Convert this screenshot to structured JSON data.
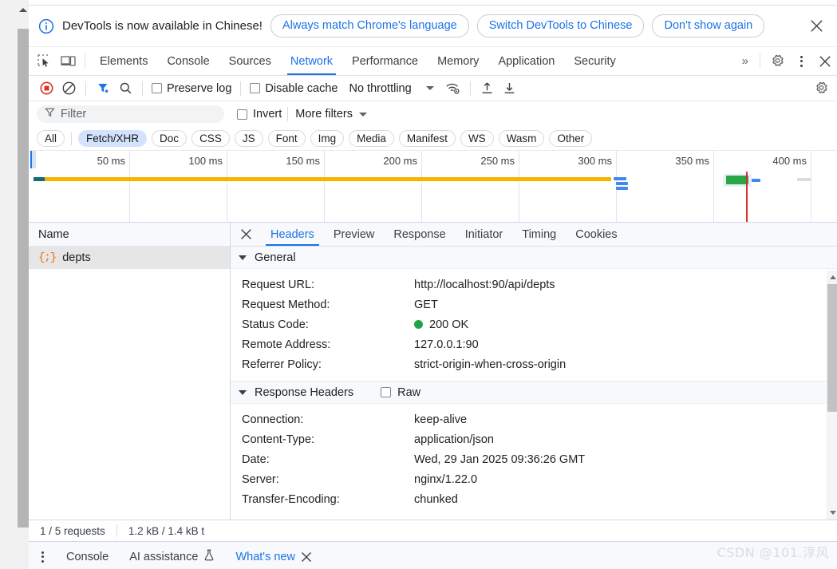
{
  "banner": {
    "icon": "info-circle-icon",
    "message": "DevTools is now available in Chinese!",
    "buttons": [
      {
        "label": "Always match Chrome's language"
      },
      {
        "label": "Switch DevTools to Chinese"
      },
      {
        "label": "Don't show again"
      }
    ],
    "close_icon": "close-icon"
  },
  "tabbar": {
    "inspect_icon": "inspect-element-icon",
    "device_icon": "device-toolbar-icon",
    "tabs": [
      {
        "label": "Elements",
        "active": false
      },
      {
        "label": "Console",
        "active": false
      },
      {
        "label": "Sources",
        "active": false
      },
      {
        "label": "Network",
        "active": true
      },
      {
        "label": "Performance",
        "active": false
      },
      {
        "label": "Memory",
        "active": false
      },
      {
        "label": "Application",
        "active": false
      },
      {
        "label": "Security",
        "active": false
      }
    ],
    "more_tabs": "»",
    "settings_icon": "gear-icon",
    "menu_icon": "kebab-menu-icon",
    "close_icon": "close-icon"
  },
  "network_toolbar": {
    "record_icon": "record-stop-icon",
    "clear_icon": "clear-icon",
    "filter_icon": "filter-funnel-icon",
    "search_icon": "search-icon",
    "preserve_log": {
      "label": "Preserve log",
      "checked": false
    },
    "disable_cache": {
      "label": "Disable cache",
      "checked": false
    },
    "throttling": {
      "value": "No throttling"
    },
    "network_conditions_icon": "wifi-settings-icon",
    "import_icon": "import-har-icon",
    "export_icon": "export-har-icon",
    "settings_icon": "gear-icon"
  },
  "filter_row": {
    "filter_icon": "filter-funnel-icon",
    "placeholder": "Filter",
    "value": "",
    "invert": {
      "label": "Invert",
      "checked": false
    },
    "more_filters": "More filters"
  },
  "type_chips": [
    {
      "label": "All",
      "active": false
    },
    {
      "label": "Fetch/XHR",
      "active": true
    },
    {
      "label": "Doc",
      "active": false
    },
    {
      "label": "CSS",
      "active": false
    },
    {
      "label": "JS",
      "active": false
    },
    {
      "label": "Font",
      "active": false
    },
    {
      "label": "Img",
      "active": false
    },
    {
      "label": "Media",
      "active": false
    },
    {
      "label": "Manifest",
      "active": false
    },
    {
      "label": "WS",
      "active": false
    },
    {
      "label": "Wasm",
      "active": false
    },
    {
      "label": "Other",
      "active": false
    }
  ],
  "overview": {
    "ticks": [
      "50 ms",
      "100 ms",
      "150 ms",
      "200 ms",
      "250 ms",
      "300 ms",
      "350 ms",
      "400 ms"
    ],
    "accent_yellow": "#f5b400",
    "accent_blue": "#4285f4",
    "accent_green": "#2aa745",
    "accent_red": "#d93025"
  },
  "requests": {
    "column_header": "Name",
    "rows": [
      {
        "name": "depts",
        "icon": "json-resource-icon",
        "selected": true
      }
    ]
  },
  "details": {
    "close_icon": "close-icon",
    "tabs": [
      {
        "label": "Headers",
        "active": true
      },
      {
        "label": "Preview",
        "active": false
      },
      {
        "label": "Response",
        "active": false
      },
      {
        "label": "Initiator",
        "active": false
      },
      {
        "label": "Timing",
        "active": false
      },
      {
        "label": "Cookies",
        "active": false
      }
    ],
    "sections": [
      {
        "title": "General",
        "expanded": true,
        "raw_toggle": null,
        "rows": [
          {
            "key": "Request URL:",
            "value": "http://localhost:90/api/depts",
            "status_dot": null
          },
          {
            "key": "Request Method:",
            "value": "GET",
            "status_dot": null
          },
          {
            "key": "Status Code:",
            "value": "200 OK",
            "status_dot": "#1ea446"
          },
          {
            "key": "Remote Address:",
            "value": "127.0.0.1:90",
            "status_dot": null
          },
          {
            "key": "Referrer Policy:",
            "value": "strict-origin-when-cross-origin",
            "status_dot": null
          }
        ]
      },
      {
        "title": "Response Headers",
        "expanded": true,
        "raw_toggle": {
          "label": "Raw",
          "checked": false
        },
        "rows": [
          {
            "key": "Connection:",
            "value": "keep-alive",
            "status_dot": null
          },
          {
            "key": "Content-Type:",
            "value": "application/json",
            "status_dot": null
          },
          {
            "key": "Date:",
            "value": "Wed, 29 Jan 2025 09:36:26 GMT",
            "status_dot": null
          },
          {
            "key": "Server:",
            "value": "nginx/1.22.0",
            "status_dot": null
          },
          {
            "key": "Transfer-Encoding:",
            "value": "chunked",
            "status_dot": null
          }
        ]
      }
    ]
  },
  "statusbar": {
    "requests": "1 / 5 requests",
    "transferred": "1.2 kB / 1.4 kB t"
  },
  "drawer": {
    "menu_icon": "kebab-menu-icon",
    "tabs": [
      {
        "label": "Console",
        "active": false,
        "icon": null
      },
      {
        "label": "AI assistance",
        "active": false,
        "icon": "flask-icon"
      },
      {
        "label": "What's new",
        "active": true,
        "icon": null
      }
    ],
    "close_icon": "close-icon"
  },
  "watermark": "CSDN @101.淳风"
}
